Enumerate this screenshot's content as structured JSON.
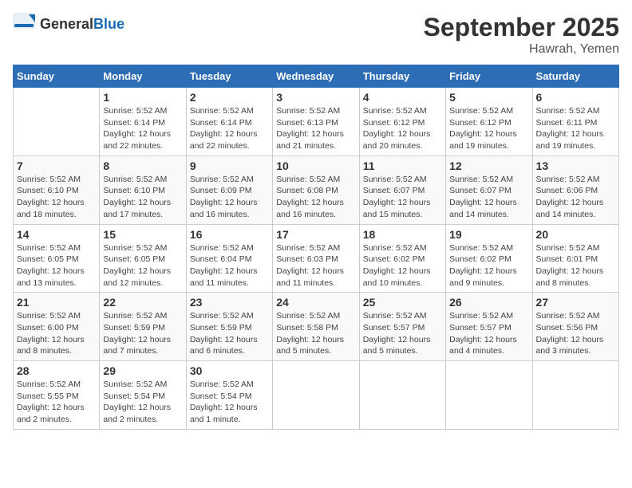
{
  "header": {
    "logo_general": "General",
    "logo_blue": "Blue",
    "month": "September 2025",
    "location": "Hawrah, Yemen"
  },
  "days_of_week": [
    "Sunday",
    "Monday",
    "Tuesday",
    "Wednesday",
    "Thursday",
    "Friday",
    "Saturday"
  ],
  "weeks": [
    [
      {
        "day": "",
        "info": ""
      },
      {
        "day": "1",
        "info": "Sunrise: 5:52 AM\nSunset: 6:14 PM\nDaylight: 12 hours\nand 22 minutes."
      },
      {
        "day": "2",
        "info": "Sunrise: 5:52 AM\nSunset: 6:14 PM\nDaylight: 12 hours\nand 22 minutes."
      },
      {
        "day": "3",
        "info": "Sunrise: 5:52 AM\nSunset: 6:13 PM\nDaylight: 12 hours\nand 21 minutes."
      },
      {
        "day": "4",
        "info": "Sunrise: 5:52 AM\nSunset: 6:12 PM\nDaylight: 12 hours\nand 20 minutes."
      },
      {
        "day": "5",
        "info": "Sunrise: 5:52 AM\nSunset: 6:12 PM\nDaylight: 12 hours\nand 19 minutes."
      },
      {
        "day": "6",
        "info": "Sunrise: 5:52 AM\nSunset: 6:11 PM\nDaylight: 12 hours\nand 19 minutes."
      }
    ],
    [
      {
        "day": "7",
        "info": "Sunrise: 5:52 AM\nSunset: 6:10 PM\nDaylight: 12 hours\nand 18 minutes."
      },
      {
        "day": "8",
        "info": "Sunrise: 5:52 AM\nSunset: 6:10 PM\nDaylight: 12 hours\nand 17 minutes."
      },
      {
        "day": "9",
        "info": "Sunrise: 5:52 AM\nSunset: 6:09 PM\nDaylight: 12 hours\nand 16 minutes."
      },
      {
        "day": "10",
        "info": "Sunrise: 5:52 AM\nSunset: 6:08 PM\nDaylight: 12 hours\nand 16 minutes."
      },
      {
        "day": "11",
        "info": "Sunrise: 5:52 AM\nSunset: 6:07 PM\nDaylight: 12 hours\nand 15 minutes."
      },
      {
        "day": "12",
        "info": "Sunrise: 5:52 AM\nSunset: 6:07 PM\nDaylight: 12 hours\nand 14 minutes."
      },
      {
        "day": "13",
        "info": "Sunrise: 5:52 AM\nSunset: 6:06 PM\nDaylight: 12 hours\nand 14 minutes."
      }
    ],
    [
      {
        "day": "14",
        "info": "Sunrise: 5:52 AM\nSunset: 6:05 PM\nDaylight: 12 hours\nand 13 minutes."
      },
      {
        "day": "15",
        "info": "Sunrise: 5:52 AM\nSunset: 6:05 PM\nDaylight: 12 hours\nand 12 minutes."
      },
      {
        "day": "16",
        "info": "Sunrise: 5:52 AM\nSunset: 6:04 PM\nDaylight: 12 hours\nand 11 minutes."
      },
      {
        "day": "17",
        "info": "Sunrise: 5:52 AM\nSunset: 6:03 PM\nDaylight: 12 hours\nand 11 minutes."
      },
      {
        "day": "18",
        "info": "Sunrise: 5:52 AM\nSunset: 6:02 PM\nDaylight: 12 hours\nand 10 minutes."
      },
      {
        "day": "19",
        "info": "Sunrise: 5:52 AM\nSunset: 6:02 PM\nDaylight: 12 hours\nand 9 minutes."
      },
      {
        "day": "20",
        "info": "Sunrise: 5:52 AM\nSunset: 6:01 PM\nDaylight: 12 hours\nand 8 minutes."
      }
    ],
    [
      {
        "day": "21",
        "info": "Sunrise: 5:52 AM\nSunset: 6:00 PM\nDaylight: 12 hours\nand 8 minutes."
      },
      {
        "day": "22",
        "info": "Sunrise: 5:52 AM\nSunset: 5:59 PM\nDaylight: 12 hours\nand 7 minutes."
      },
      {
        "day": "23",
        "info": "Sunrise: 5:52 AM\nSunset: 5:59 PM\nDaylight: 12 hours\nand 6 minutes."
      },
      {
        "day": "24",
        "info": "Sunrise: 5:52 AM\nSunset: 5:58 PM\nDaylight: 12 hours\nand 5 minutes."
      },
      {
        "day": "25",
        "info": "Sunrise: 5:52 AM\nSunset: 5:57 PM\nDaylight: 12 hours\nand 5 minutes."
      },
      {
        "day": "26",
        "info": "Sunrise: 5:52 AM\nSunset: 5:57 PM\nDaylight: 12 hours\nand 4 minutes."
      },
      {
        "day": "27",
        "info": "Sunrise: 5:52 AM\nSunset: 5:56 PM\nDaylight: 12 hours\nand 3 minutes."
      }
    ],
    [
      {
        "day": "28",
        "info": "Sunrise: 5:52 AM\nSunset: 5:55 PM\nDaylight: 12 hours\nand 2 minutes."
      },
      {
        "day": "29",
        "info": "Sunrise: 5:52 AM\nSunset: 5:54 PM\nDaylight: 12 hours\nand 2 minutes."
      },
      {
        "day": "30",
        "info": "Sunrise: 5:52 AM\nSunset: 5:54 PM\nDaylight: 12 hours\nand 1 minute."
      },
      {
        "day": "",
        "info": ""
      },
      {
        "day": "",
        "info": ""
      },
      {
        "day": "",
        "info": ""
      },
      {
        "day": "",
        "info": ""
      }
    ]
  ]
}
